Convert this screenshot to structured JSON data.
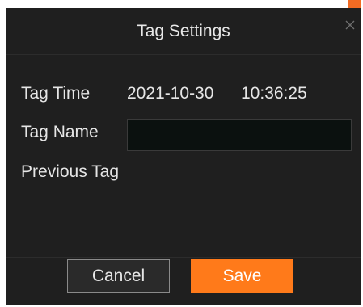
{
  "dialog": {
    "title": "Tag Settings",
    "close_icon": "close-icon"
  },
  "fields": {
    "tag_time_label": "Tag Time",
    "tag_time_date": "2021-10-30",
    "tag_time_clock": "10:36:25",
    "tag_name_label": "Tag Name",
    "tag_name_value": "",
    "previous_tag_label": "Previous Tag"
  },
  "buttons": {
    "cancel_label": "Cancel",
    "save_label": "Save"
  },
  "colors": {
    "accent": "#ff7a1a",
    "dialog_background": "#1f1f1f",
    "input_background": "#0b110f"
  }
}
